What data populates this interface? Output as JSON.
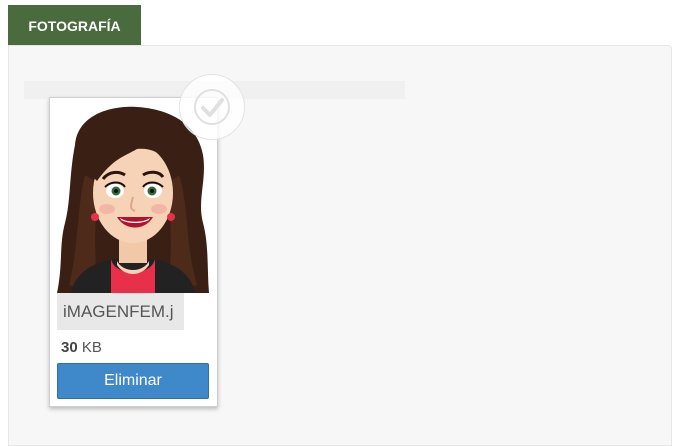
{
  "section": {
    "title": "FOTOGRAFÍA"
  },
  "file": {
    "name": "iMAGENFEM.j",
    "size_value": "30",
    "size_unit": "KB",
    "remove_label": "Eliminar",
    "upload_complete": true
  },
  "icons": {
    "status": "check-icon",
    "thumbnail": "avatar-woman-thumbnail"
  },
  "colors": {
    "section_tab": "#4a6b3d",
    "button": "#3f88c9",
    "panel_bg": "#f7f7f7"
  }
}
